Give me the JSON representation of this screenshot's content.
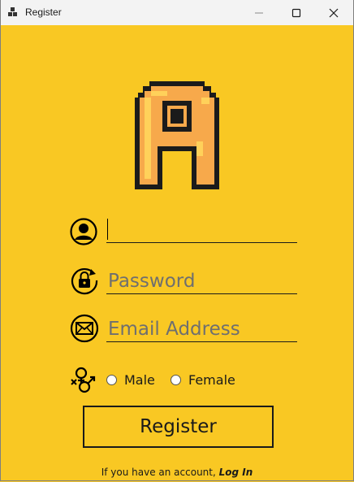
{
  "window": {
    "title": "Register",
    "icon": "app-grid-icon",
    "controls": [
      "minimize-icon",
      "maximize-icon",
      "close-icon"
    ]
  },
  "logo": {
    "icon": "pixel-letter-a-logo"
  },
  "form": {
    "username": {
      "value": "",
      "placeholder": "",
      "icon": "user-icon"
    },
    "password": {
      "value": "",
      "placeholder": "Password",
      "icon": "lock-refresh-icon"
    },
    "email": {
      "value": "",
      "placeholder": "Email Address",
      "icon": "envelope-icon"
    },
    "gender": {
      "icon": "gender-icon",
      "options": [
        {
          "label": "Male",
          "selected": false
        },
        {
          "label": "Female",
          "selected": false
        }
      ]
    },
    "register_label": "Register"
  },
  "footer": {
    "prompt": "If you have an account, ",
    "login_label": "Log In"
  },
  "colors": {
    "background": "#f9c823",
    "titlebar": "#f3f3f3",
    "text": "#1a1a1a"
  }
}
